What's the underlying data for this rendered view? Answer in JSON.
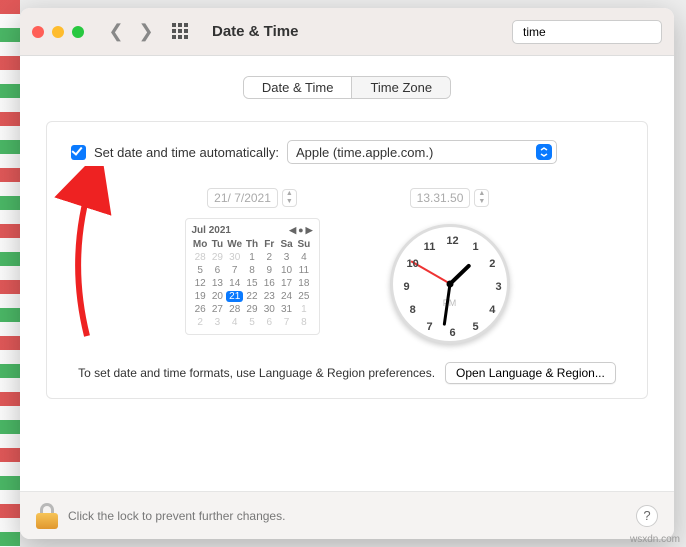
{
  "titlebar": {
    "title": "Date & Time",
    "search_value": "time"
  },
  "tabs": {
    "date_time": "Date & Time",
    "time_zone": "Time Zone"
  },
  "auto": {
    "label": "Set date and time automatically:",
    "server": "Apple (time.apple.com.)"
  },
  "date_field": "21/ 7/2021",
  "time_field": "13.31.50",
  "calendar": {
    "month": "Jul 2021",
    "dow": [
      "Mo",
      "Tu",
      "We",
      "Th",
      "Fr",
      "Sa",
      "Su"
    ],
    "leading": [
      28,
      29,
      30
    ],
    "days": 31,
    "today": 21,
    "trailing": [
      1,
      2,
      3,
      4,
      5,
      6,
      7,
      8
    ]
  },
  "clock": {
    "ampm": "PM"
  },
  "footer": {
    "hint": "To set date and time formats, use Language & Region preferences.",
    "button": "Open Language & Region..."
  },
  "lock": {
    "text": "Click the lock to prevent further changes."
  },
  "watermark": "wsxdn.com"
}
